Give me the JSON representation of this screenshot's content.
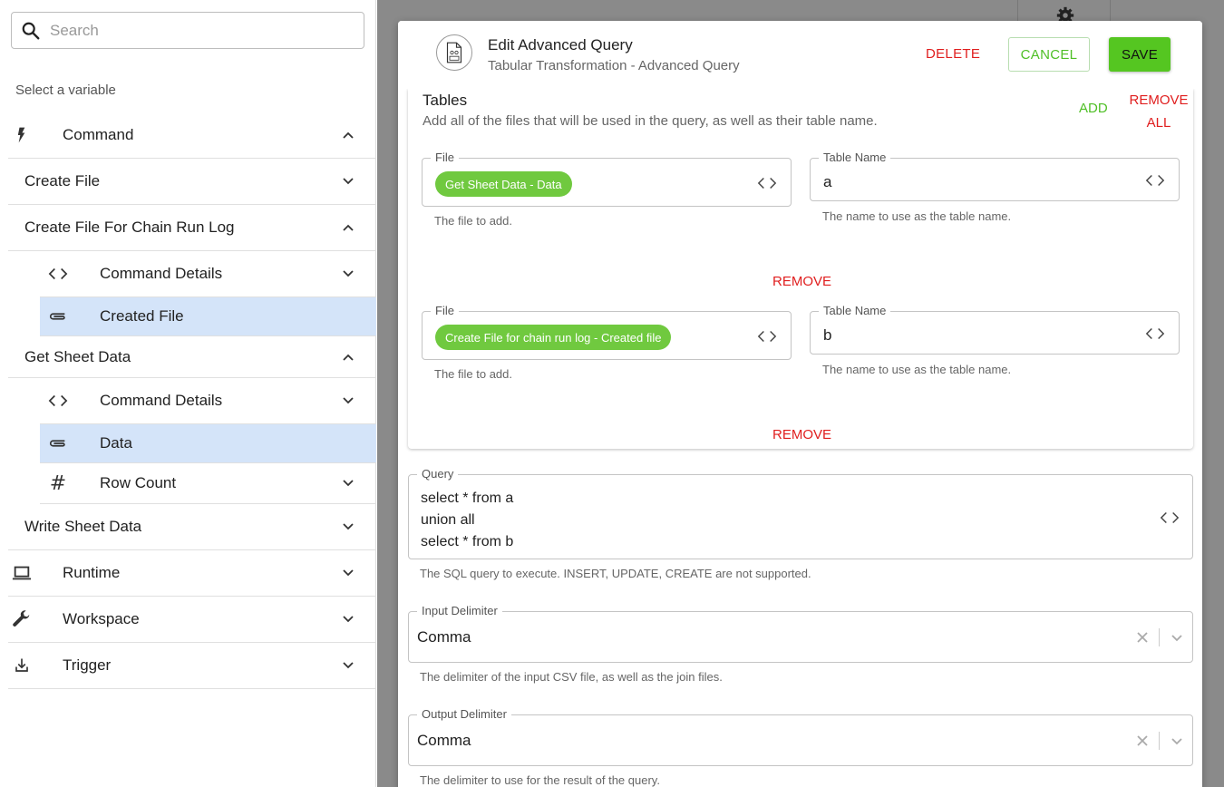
{
  "search": {
    "placeholder": "Search"
  },
  "sidebar": {
    "select_label": "Select a variable",
    "items": [
      {
        "label": "Command",
        "level": 0,
        "icon": "lightning-icon",
        "chevron": "up"
      },
      {
        "label": "Create File",
        "level": 1,
        "chevron": "down"
      },
      {
        "label": "Create File For Chain Run Log",
        "level": 1,
        "chevron": "up"
      },
      {
        "label": "Command Details",
        "level": 2,
        "icon": "code-icon",
        "chevron": "down"
      },
      {
        "label": "Created File",
        "level": 2,
        "icon": "attachment-icon",
        "selected": true
      },
      {
        "label": "Get Sheet Data",
        "level": 1,
        "chevron": "up"
      },
      {
        "label": "Command Details",
        "level": 2,
        "icon": "code-icon",
        "chevron": "down"
      },
      {
        "label": "Data",
        "level": 2,
        "icon": "attachment-icon",
        "selected": true
      },
      {
        "label": "Row Count",
        "level": 2,
        "icon": "hash-icon",
        "chevron": "down"
      },
      {
        "label": "Write Sheet Data",
        "level": 1,
        "chevron": "down"
      },
      {
        "label": "Runtime",
        "level": 0,
        "icon": "laptop-icon",
        "chevron": "down"
      },
      {
        "label": "Workspace",
        "level": 0,
        "icon": "wrench-icon",
        "chevron": "down"
      },
      {
        "label": "Trigger",
        "level": 0,
        "icon": "trigger-icon",
        "chevron": "down"
      }
    ]
  },
  "dialog": {
    "title": "Edit Advanced Query",
    "subtitle": "Tabular Transformation - Advanced Query",
    "delete_label": "DELETE",
    "cancel_label": "CANCEL",
    "save_label": "SAVE",
    "tables": {
      "title": "Tables",
      "description": "Add all of the files that will be used in the query, as well as their table name.",
      "add_label": "ADD",
      "remove_all_label": "REMOVE ALL",
      "remove_label": "REMOVE",
      "rows": [
        {
          "file_label": "File",
          "file_chip": "Get Sheet Data - Data",
          "file_helper": "The file to add.",
          "name_label": "Table Name",
          "name_value": "a",
          "name_helper": "The name to use as the table name."
        },
        {
          "file_label": "File",
          "file_chip": "Create File for chain run log - Created file",
          "file_helper": "The file to add.",
          "name_label": "Table Name",
          "name_value": "b",
          "name_helper": "The name to use as the table name."
        }
      ]
    },
    "query": {
      "label": "Query",
      "lines": [
        "select * from a",
        "union all",
        "select * from b"
      ],
      "helper": "The SQL query to execute. INSERT, UPDATE, CREATE are not supported."
    },
    "input_delimiter": {
      "label": "Input Delimiter",
      "value": "Comma",
      "helper": "The delimiter of the input CSV file, as well as the join files."
    },
    "output_delimiter": {
      "label": "Output Delimiter",
      "value": "Comma",
      "helper": "The delimiter to use for the result of the query."
    }
  },
  "colors": {
    "accent_green": "#55c621",
    "danger_red": "#e01e1e",
    "selected_row": "#d4e4f9"
  }
}
